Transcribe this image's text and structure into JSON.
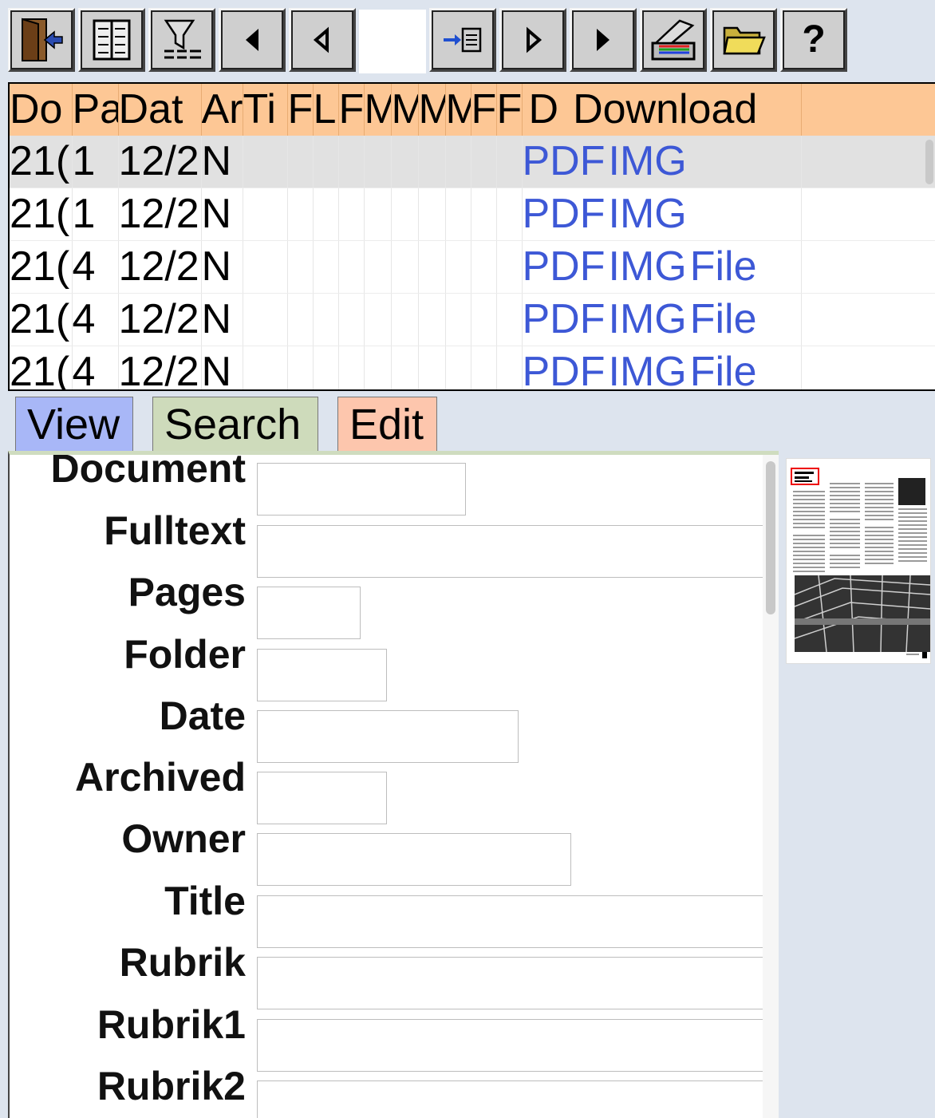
{
  "toolbar": {
    "buttons": [
      {
        "name": "exit-button",
        "icon": "exit-door-icon"
      },
      {
        "name": "book-view-button",
        "icon": "book-icon"
      },
      {
        "name": "filter-button",
        "icon": "filter-icon"
      },
      {
        "name": "first-record-button",
        "icon": "triangle-left-filled-icon"
      },
      {
        "name": "prev-record-button",
        "icon": "triangle-left-outline-icon"
      },
      {
        "name": "goto-record-button",
        "icon": "goto-arrow-icon"
      },
      {
        "name": "next-record-button",
        "icon": "triangle-right-outline-icon"
      },
      {
        "name": "last-record-button",
        "icon": "triangle-right-filled-icon"
      },
      {
        "name": "scan-button",
        "icon": "scanner-icon"
      },
      {
        "name": "open-folder-button",
        "icon": "folder-icon"
      },
      {
        "name": "help-button",
        "icon": "help-icon",
        "label": "?"
      }
    ],
    "record_input_value": ""
  },
  "grid": {
    "columns": [
      "Do",
      "Pa",
      "Dat",
      "Ar",
      "Ti",
      "F",
      "L",
      "F",
      "M",
      "M",
      "M",
      "M",
      "F",
      "F",
      "D",
      "Download"
    ],
    "rows": [
      {
        "doc": "21(",
        "pages": "1",
        "date": "12/2",
        "owner": "N",
        "links": [
          "PDF",
          "IMG"
        ],
        "selected": true
      },
      {
        "doc": "21(",
        "pages": "1",
        "date": "12/2",
        "owner": "N",
        "links": [
          "PDF",
          "IMG"
        ],
        "selected": false
      },
      {
        "doc": "21(",
        "pages": "4",
        "date": "12/2",
        "owner": "N",
        "links": [
          "PDF",
          "IMG",
          "File"
        ],
        "selected": false
      },
      {
        "doc": "21(",
        "pages": "4",
        "date": "12/2",
        "owner": "N",
        "links": [
          "PDF",
          "IMG",
          "File"
        ],
        "selected": false
      },
      {
        "doc": "21(",
        "pages": "4",
        "date": "12/2",
        "owner": "N",
        "links": [
          "PDF",
          "IMG",
          "File"
        ],
        "selected": false
      }
    ]
  },
  "tabs": {
    "view": "View",
    "search": "Search",
    "edit": "Edit",
    "active": "search"
  },
  "form": {
    "fields": [
      {
        "label": "Document",
        "value": ""
      },
      {
        "label": "Fulltext",
        "value": ""
      },
      {
        "label": "Pages",
        "value": ""
      },
      {
        "label": "Folder",
        "value": ""
      },
      {
        "label": "Date",
        "value": ""
      },
      {
        "label": "Archived",
        "value": ""
      },
      {
        "label": "Owner",
        "value": ""
      },
      {
        "label": "Title",
        "value": ""
      },
      {
        "label": "Rubrik",
        "value": ""
      },
      {
        "label": "Rubrik1",
        "value": ""
      },
      {
        "label": "Rubrik2",
        "value": ""
      }
    ]
  },
  "colors": {
    "header_bg": "#fdc795",
    "link": "#3d58d6",
    "tab_view": "#a8b7f7",
    "tab_search": "#cedbbb",
    "tab_edit": "#fdc6ad",
    "page_bg": "#dde4ee"
  }
}
